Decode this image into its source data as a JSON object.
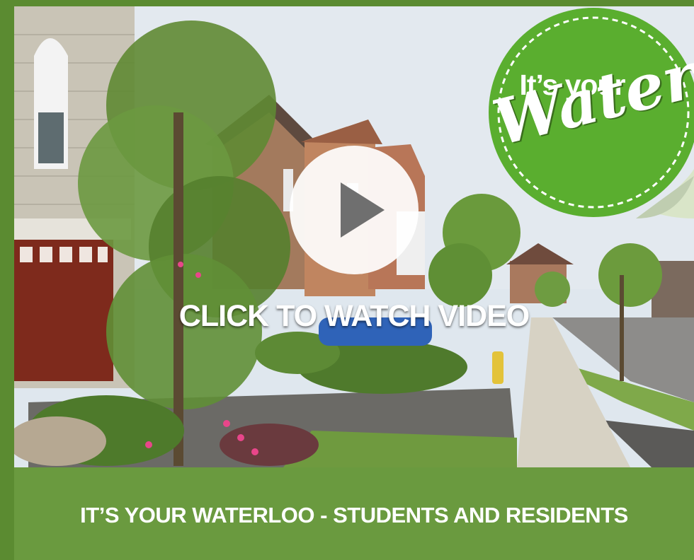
{
  "video": {
    "cta_label": "CLICK TO WATCH VIDEO",
    "play_icon": "play-icon"
  },
  "badge": {
    "line1": "It’s your",
    "line2": "Waterloo",
    "color": "#5aae2f"
  },
  "footer": {
    "title": "IT’S YOUR WATERLOO - STUDENTS AND RESIDENTS"
  },
  "colors": {
    "frame": "#5b8b31",
    "footer_bg": "#6a9a3f",
    "text": "#ffffff"
  }
}
